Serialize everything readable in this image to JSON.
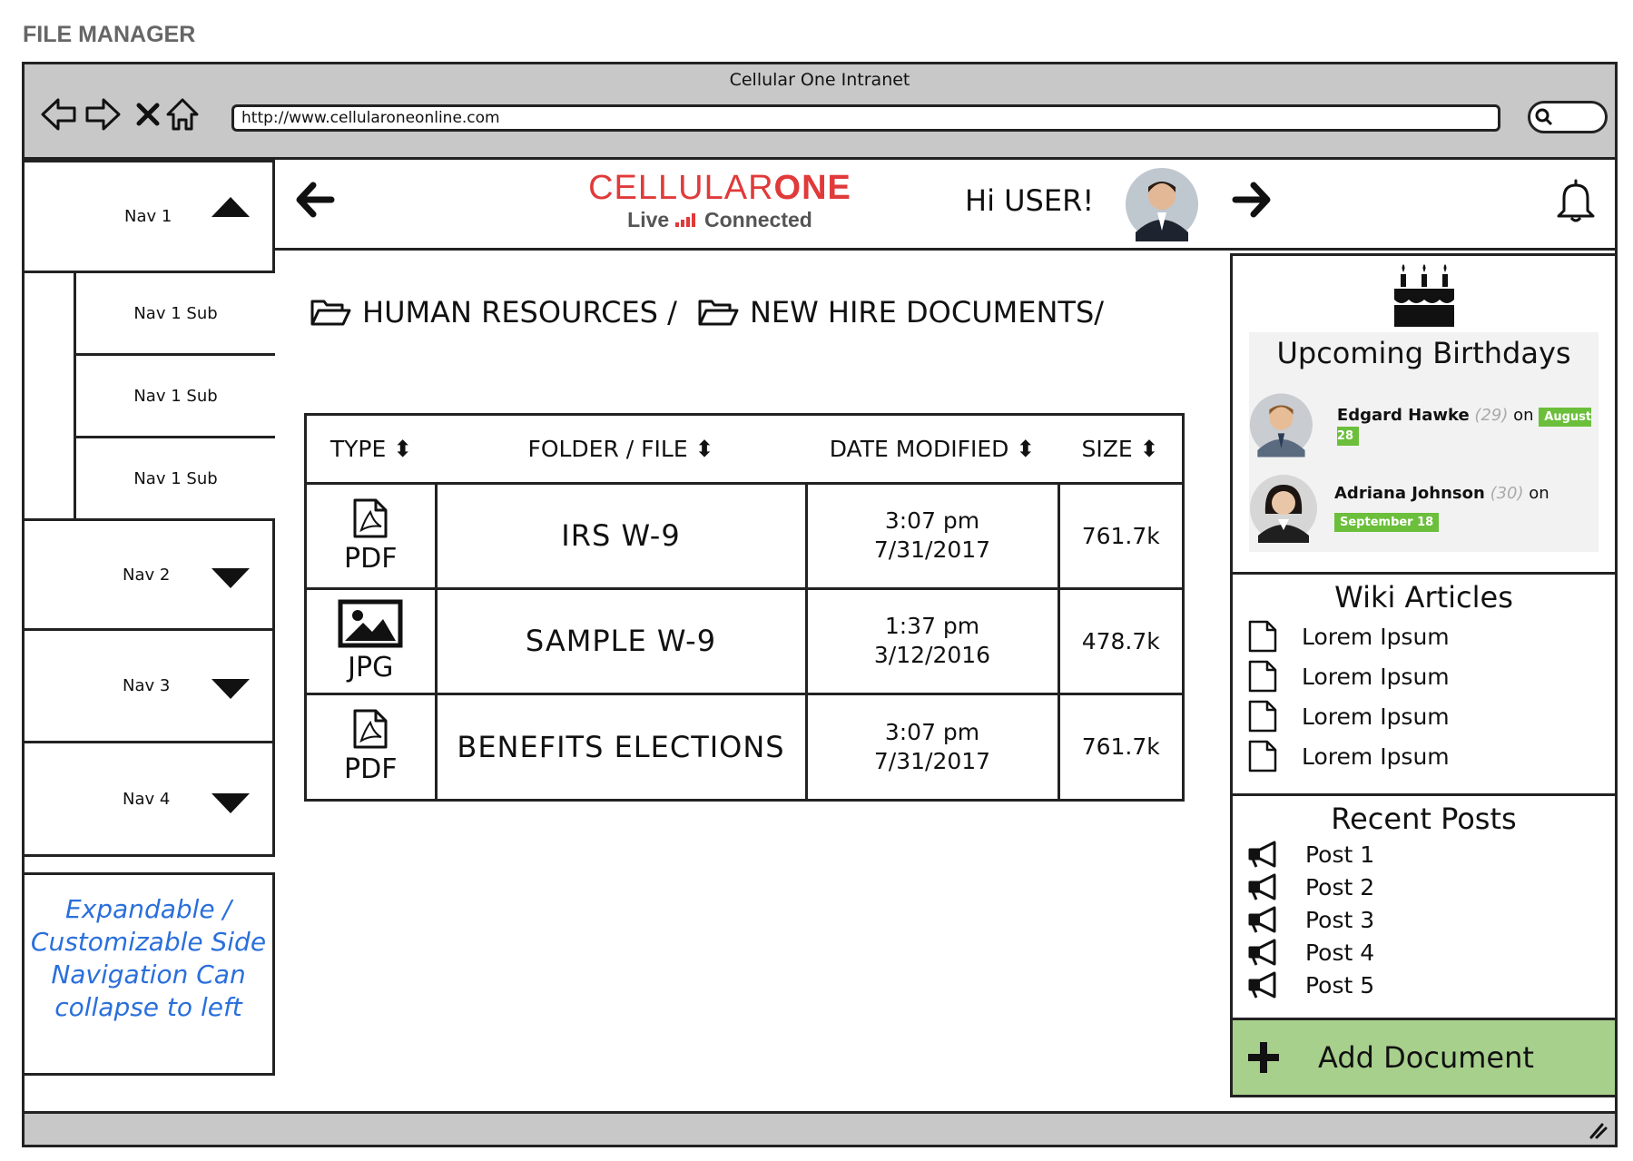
{
  "page_title": "FILE MANAGER",
  "browser": {
    "title": "Cellular One Intranet",
    "url": "http://www.cellularoneonline.com"
  },
  "sidebar": {
    "items": [
      {
        "label": "Nav 1",
        "expanded": true,
        "subs": [
          "Nav 1 Sub",
          "Nav 1 Sub",
          "Nav 1 Sub"
        ]
      },
      {
        "label": "Nav 2",
        "expanded": false
      },
      {
        "label": "Nav 3",
        "expanded": false
      },
      {
        "label": "Nav 4",
        "expanded": false
      }
    ],
    "note": "Expandable / Customizable Side Navigation Can collapse to left"
  },
  "header": {
    "logo_main": "CELLULAR",
    "logo_bold": "ONE",
    "logo_tag_left": "Live",
    "logo_tag_right": "Connected",
    "greeting": "Hi USER!"
  },
  "breadcrumb": [
    "HUMAN RESOURCES /",
    "NEW HIRE DOCUMENTS/"
  ],
  "table": {
    "headers": [
      "TYPE",
      "FOLDER / FILE",
      "DATE MODIFIED",
      "SIZE"
    ],
    "rows": [
      {
        "type": "PDF",
        "name": "IRS W-9",
        "time": "3:07 pm",
        "date": "7/31/2017",
        "size": "761.7k"
      },
      {
        "type": "JPG",
        "name": "SAMPLE W-9",
        "time": "1:37 pm",
        "date": "3/12/2016",
        "size": "478.7k"
      },
      {
        "type": "PDF",
        "name": "BENEFITS ELECTIONS",
        "time": "3:07 pm",
        "date": "7/31/2017",
        "size": "761.7k"
      }
    ]
  },
  "birthdays": {
    "title": "Upcoming Birthdays",
    "people": [
      {
        "name": "Edgard Hawke",
        "age": "(29)",
        "on": "on",
        "date": "August 28"
      },
      {
        "name": "Adriana Johnson",
        "age": "(30)",
        "on": "on",
        "date": "September 18"
      }
    ]
  },
  "wiki": {
    "title": "Wiki Articles",
    "items": [
      "Lorem Ipsum",
      "Lorem Ipsum",
      "Lorem Ipsum",
      "Lorem Ipsum"
    ]
  },
  "posts": {
    "title": "Recent Posts",
    "items": [
      "Post 1",
      "Post 2",
      "Post 3",
      "Post 4",
      "Post 5"
    ]
  },
  "add_document": "Add Document",
  "colors": {
    "logo_red": "#e03a3a",
    "add_green": "#a8d08d",
    "badge_green": "#6bbf3b",
    "note_blue": "#2a6fdb"
  }
}
